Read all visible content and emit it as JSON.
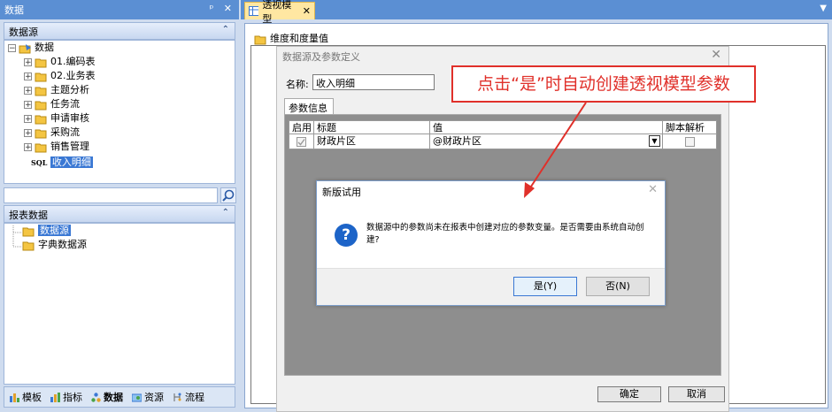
{
  "left_panel": {
    "title": "数据",
    "title_buttons": "ᵖ ✕",
    "datasource_section": {
      "header": "数据源",
      "root": "数据",
      "items": [
        "01.编码表",
        "02.业务表",
        "主题分析",
        "任务流",
        "申请审核",
        "采购流",
        "销售管理"
      ],
      "selected_item_prefix": "SQL",
      "selected_item": "收入明细"
    },
    "report_section": {
      "header": "报表数据",
      "items": [
        "数据源",
        "字典数据源"
      ]
    },
    "bottom_tabs": [
      "模板",
      "指标",
      "数据",
      "资源",
      "流程"
    ]
  },
  "main": {
    "tab_label": "透视模型",
    "tab_close": "✕",
    "root_node": "维度和度量值"
  },
  "param_dialog": {
    "title": "数据源及参数定义",
    "close": "✕",
    "name_label": "名称:",
    "name_value": "收入明细",
    "tab": "参数信息",
    "columns": [
      "启用",
      "标题",
      "值",
      "脚本解析"
    ],
    "row": {
      "title": "财政片区",
      "value": "@财政片区"
    },
    "ok": "确定",
    "cancel": "取消"
  },
  "confirm_dialog": {
    "title": "新版试用",
    "close": "✕",
    "message": "数据源中的参数尚未在报表中创建对应的参数变量。是否需要由系统自动创建?",
    "yes": "是(Y)",
    "no": "否(N)"
  },
  "annotation": {
    "text": "点击“是”时自动创建透视模型参数"
  },
  "colors": {
    "dock_blue": "#5b8fd3",
    "annotation_red": "#e0302a",
    "selection": "#3a78d4",
    "question_icon": "#1d64c8"
  }
}
